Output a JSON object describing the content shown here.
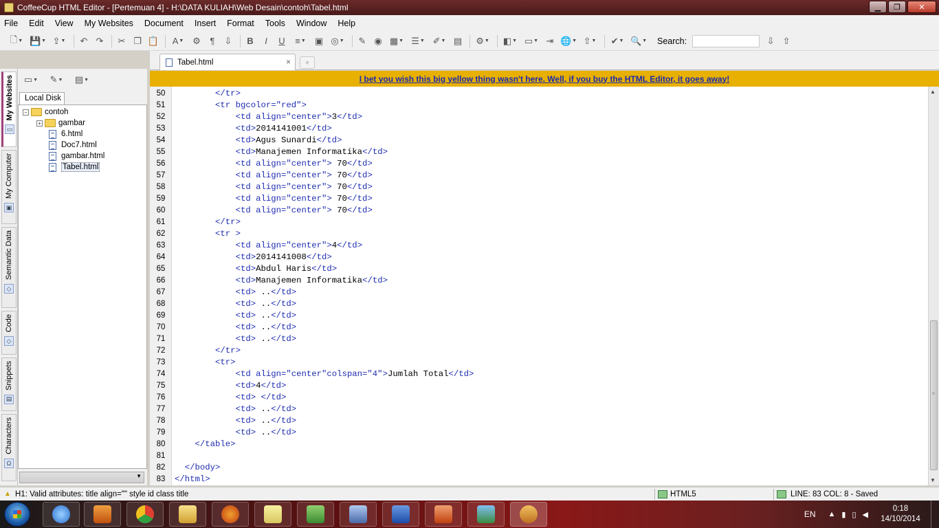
{
  "window": {
    "title": "CoffeeCup HTML Editor - [Pertemuan 4] - H:\\DATA KULIAH\\Web Desain\\contoh\\Tabel.html",
    "min": "▁",
    "max": "❐",
    "close": "✕"
  },
  "menu": [
    "File",
    "Edit",
    "View",
    "My Websites",
    "Document",
    "Insert",
    "Format",
    "Tools",
    "Window",
    "Help"
  ],
  "toolbar": {
    "search_label": "Search:",
    "search_value": ""
  },
  "side_tabs": [
    "My Websites",
    "My Computer",
    "Semantic Data",
    "Code",
    "Snippets",
    "Characters"
  ],
  "left_panel": {
    "tab_label": "Local Disk",
    "tree": {
      "root": "contoh",
      "items": [
        "gambar",
        "6.html",
        "Doc7.html",
        "gambar.html",
        "Tabel.html"
      ]
    }
  },
  "doc_tab": {
    "label": "Tabel.html",
    "close": "×",
    "new": "+"
  },
  "promo": "I bet you wish this big yellow thing wasn't here. Well, if you buy the HTML Editor, it goes away!",
  "code_lines": [
    {
      "n": "50",
      "t": "        </tr>"
    },
    {
      "n": "51",
      "t": "        <tr bgcolor=\"red\">"
    },
    {
      "n": "52",
      "t": "            <td align=\"center\">3</td>"
    },
    {
      "n": "53",
      "t": "            <td>2014141001</td>"
    },
    {
      "n": "54",
      "t": "            <td>Agus Sunardi</td>"
    },
    {
      "n": "55",
      "t": "            <td>Manajemen Informatika</td>"
    },
    {
      "n": "56",
      "t": "            <td align=\"center\"> 70</td>"
    },
    {
      "n": "57",
      "t": "            <td align=\"center\"> 70</td>"
    },
    {
      "n": "58",
      "t": "            <td align=\"center\"> 70</td>"
    },
    {
      "n": "59",
      "t": "            <td align=\"center\"> 70</td>"
    },
    {
      "n": "60",
      "t": "            <td align=\"center\"> 70</td>"
    },
    {
      "n": "61",
      "t": "        </tr>"
    },
    {
      "n": "62",
      "t": "        <tr >"
    },
    {
      "n": "63",
      "t": "            <td align=\"center\">4</td>"
    },
    {
      "n": "64",
      "t": "            <td>2014141008</td>"
    },
    {
      "n": "65",
      "t": "            <td>Abdul Haris</td>"
    },
    {
      "n": "66",
      "t": "            <td>Manajemen Informatika</td>"
    },
    {
      "n": "67",
      "t": "            <td> ..</td>"
    },
    {
      "n": "68",
      "t": "            <td> ..</td>"
    },
    {
      "n": "69",
      "t": "            <td> ..</td>"
    },
    {
      "n": "70",
      "t": "            <td> ..</td>"
    },
    {
      "n": "71",
      "t": "            <td> ..</td>"
    },
    {
      "n": "72",
      "t": "        </tr>"
    },
    {
      "n": "73",
      "t": "        <tr>"
    },
    {
      "n": "74",
      "t": "            <td align=\"center\"colspan=\"4\">Jumlah Total</td>"
    },
    {
      "n": "75",
      "t": "            <td>4</td>"
    },
    {
      "n": "76",
      "t": "            <td> </td>"
    },
    {
      "n": "77",
      "t": "            <td> ..</td>"
    },
    {
      "n": "78",
      "t": "            <td> ..</td>"
    },
    {
      "n": "79",
      "t": "            <td> ..</td>"
    },
    {
      "n": "80",
      "t": "    </table>"
    },
    {
      "n": "81",
      "t": ""
    },
    {
      "n": "82",
      "t": "  </body>"
    },
    {
      "n": "83",
      "t": "</html>"
    }
  ],
  "status": {
    "message": "H1: Valid attributes: title align=\"\" style id class title",
    "mode": "HTML5",
    "position": "LINE: 83  COL: 8 - Saved"
  },
  "taskbar": {
    "lang": "EN",
    "time": "0:18",
    "date": "14/10/2014"
  },
  "colors": {
    "promo_bg": "#e8b000",
    "code_tag": "#1e2cb0",
    "titlebar": "#5a2020"
  }
}
